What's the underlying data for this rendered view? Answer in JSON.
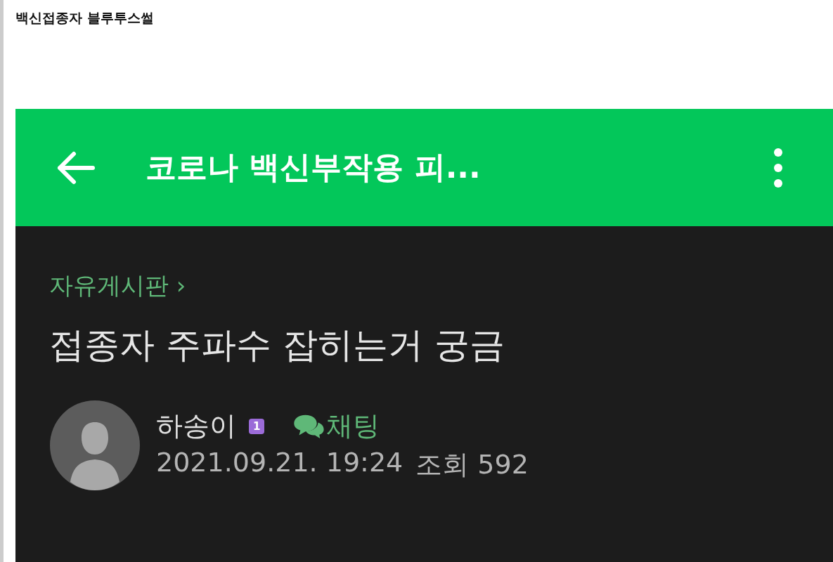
{
  "page_title": "백신접종자 블루투스썰",
  "app_bar": {
    "title": "코로나 백신부작용 피..."
  },
  "post": {
    "board": "자유게시판 ›",
    "title": "접종자 주파수 잡히는거 궁금",
    "author": "하송이",
    "level_badge": "1",
    "chat": "채팅",
    "date": "2021.09.21. 19:24",
    "views": "조회 592"
  }
}
